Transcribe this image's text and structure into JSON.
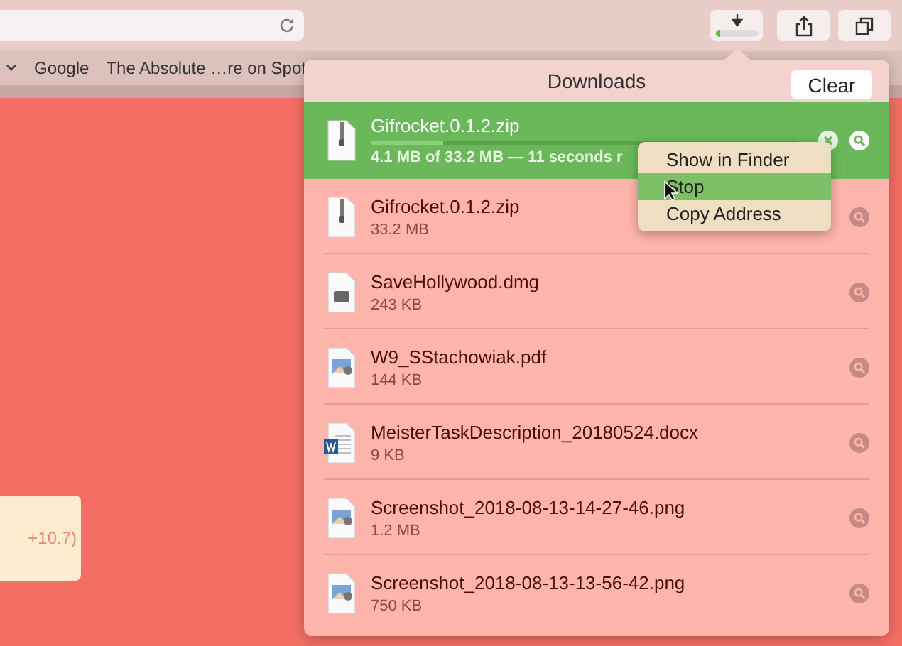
{
  "toolbar": {
    "bookmarks": [
      "Google",
      "The Absolute …re on Spot"
    ],
    "download_progress": {
      "level": 0.12
    }
  },
  "page": {
    "card_text": "+10.7)"
  },
  "downloads": {
    "title": "Downloads",
    "clear_button": "Clear",
    "items": [
      {
        "name": "Gifrocket.0.1.2.zip",
        "detail": "4.1 MB of 33.2 MB — 11 seconds r",
        "kind": "zip",
        "active": true,
        "level": 0.17
      },
      {
        "name": "Gifrocket.0.1.2.zip",
        "detail": "33.2 MB",
        "kind": "zip",
        "active": false
      },
      {
        "name": "SaveHollywood.dmg",
        "detail": "243 KB",
        "kind": "dmg",
        "active": false
      },
      {
        "name": "W9_SStachowiak.pdf",
        "detail": "144 KB",
        "kind": "pdf",
        "active": false
      },
      {
        "name": "MeisterTaskDescription_20180524.docx",
        "detail": "9 KB",
        "kind": "docx",
        "active": false
      },
      {
        "name": "Screenshot_2018-08-13-14-27-46.png",
        "detail": "1.2 MB",
        "kind": "png",
        "active": false
      },
      {
        "name": "Screenshot_2018-08-13-13-56-42.png",
        "detail": "750 KB",
        "kind": "png",
        "active": false
      }
    ]
  },
  "context_menu": [
    {
      "label": "Show in Finder",
      "selected": false
    },
    {
      "label": "Stop",
      "selected": true
    },
    {
      "label": "Copy Address",
      "selected": false
    }
  ]
}
